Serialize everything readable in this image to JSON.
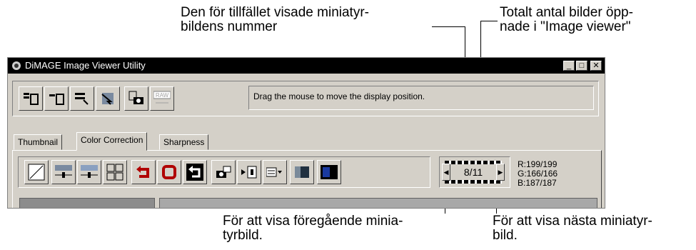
{
  "annotations": {
    "current_number": "Den för tillfället visade miniatyr-\nbildens nummer",
    "total_count": "Totalt antal bilder öpp-\nnade i \"Image viewer\"",
    "prev_thumbnail": "För att visa föregående minia-\ntyrbild.",
    "next_thumbnail": "För att visa nästa miniatyr-\nbild."
  },
  "window": {
    "title": "DiMAGE Image Viewer Utility",
    "controls": {
      "minimize": "_",
      "maximize": "□",
      "close": "✕"
    }
  },
  "toolbar": {
    "raw_label": "RAW",
    "status_message": "Drag the mouse to move the display position."
  },
  "tabs": [
    {
      "label": "Thumbnail",
      "active": false
    },
    {
      "label": "Color Correction",
      "active": true
    },
    {
      "label": "Sharpness",
      "active": false
    }
  ],
  "navigator": {
    "counter": "8/11",
    "prev_glyph": "◀",
    "next_glyph": "▶"
  },
  "rgb_readout": {
    "r": "R:199/199",
    "g": "G:166/166",
    "b": "B:187/187"
  },
  "colors": {
    "title_bar": "#000000",
    "window_face": "#d4d0c8",
    "accent_red": "#b00000",
    "accent_blue": "#1a3aa0"
  }
}
